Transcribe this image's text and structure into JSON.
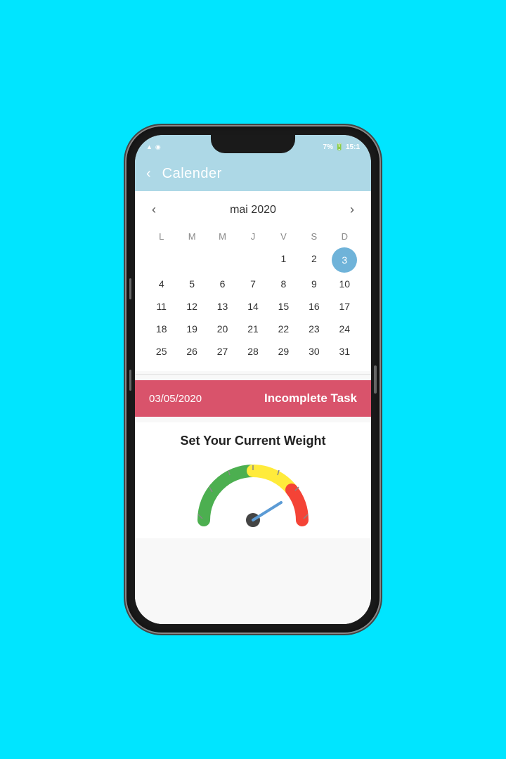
{
  "status_bar": {
    "battery": "7%",
    "time": "15:1",
    "icons": [
      "wifi",
      "signal",
      "instagram"
    ]
  },
  "header": {
    "title": "Calender",
    "back_label": "‹"
  },
  "calendar": {
    "month_label": "mai 2020",
    "prev_arrow": "‹",
    "next_arrow": "›",
    "day_headers": [
      "L",
      "M",
      "M",
      "J",
      "V",
      "S",
      "D"
    ],
    "selected_day": 3,
    "weeks": [
      [
        null,
        null,
        null,
        null,
        1,
        2,
        3
      ],
      [
        4,
        5,
        6,
        7,
        8,
        9,
        10
      ],
      [
        11,
        12,
        13,
        14,
        15,
        16,
        17
      ],
      [
        18,
        19,
        20,
        21,
        22,
        23,
        24
      ],
      [
        25,
        26,
        27,
        28,
        29,
        30,
        31
      ]
    ]
  },
  "task_bar": {
    "date": "03/05/2020",
    "label": "Incomplete Task"
  },
  "weight_section": {
    "title": "Set Your Current Weight"
  },
  "gauge": {
    "colors": {
      "green": "#4caf50",
      "yellow": "#ffeb3b",
      "red": "#f44336"
    },
    "needle_angle": 120
  }
}
